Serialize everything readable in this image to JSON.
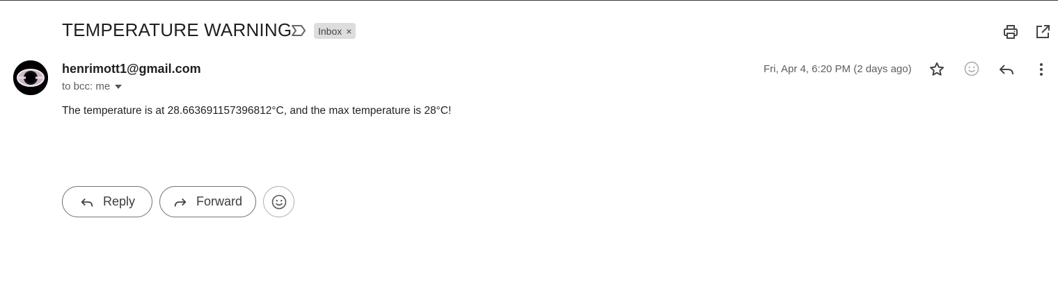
{
  "message": {
    "subject": "TEMPERATURE WARNING",
    "label": "Inbox",
    "label_remove": "×",
    "sender_email": "henrimott1@gmail.com",
    "recipients": "to bcc: me",
    "date": "Fri, Apr 4, 6:20 PM (2 days ago)",
    "body": "The temperature is at 28.663691157396812°C, and the max temperature is 28°C!"
  },
  "actions": {
    "reply_label": "Reply",
    "forward_label": "Forward"
  },
  "icons": {
    "important": "important-marker-icon",
    "print": "print-icon",
    "open_new_window": "open-in-new-window-icon",
    "star": "star-icon",
    "emoji": "emoji-reaction-icon",
    "reply": "reply-icon",
    "more": "more-vertical-icon",
    "forward": "forward-icon"
  }
}
